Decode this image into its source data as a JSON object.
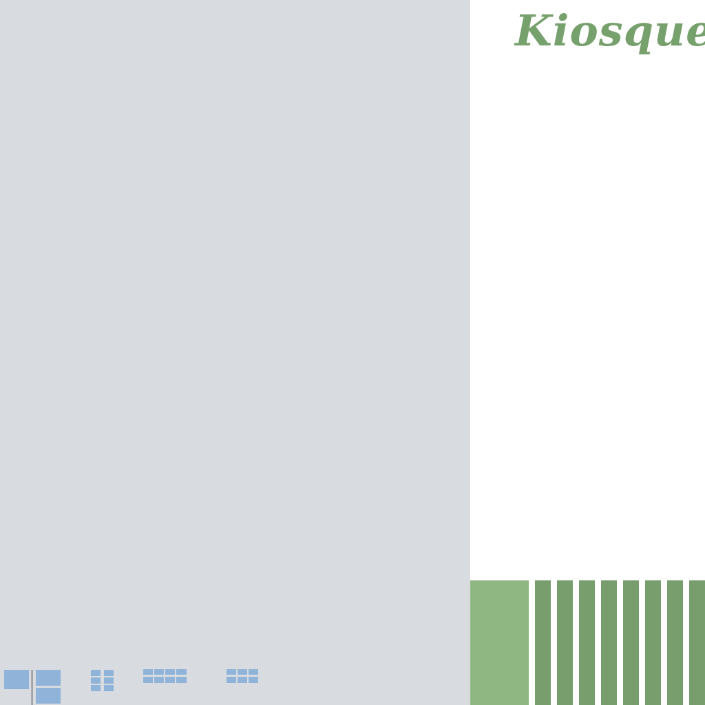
{
  "app": {
    "title": "Kiosque"
  },
  "colors": {
    "workspace_bg": "#d8dce0",
    "panel_bg": "#ffffff",
    "title_color": "#76a06c",
    "tile_light": "#8fb781",
    "tile_dark": "#779e6c",
    "layout_icon": "#8fb3d9"
  },
  "layout_selector": {
    "options": [
      {
        "name": "layout-1-plus-2-icon"
      },
      {
        "name": "layout-2x3-grid-icon"
      },
      {
        "name": "layout-4x2-grid-icon"
      },
      {
        "name": "layout-3x2-grid-icon"
      }
    ]
  },
  "tiles": {
    "big": {
      "name": "tile-large"
    },
    "bars": [
      {
        "name": "tile-bar-1"
      },
      {
        "name": "tile-bar-2"
      },
      {
        "name": "tile-bar-3"
      },
      {
        "name": "tile-bar-4"
      },
      {
        "name": "tile-bar-5"
      },
      {
        "name": "tile-bar-6"
      },
      {
        "name": "tile-bar-7"
      },
      {
        "name": "tile-bar-8"
      }
    ]
  }
}
